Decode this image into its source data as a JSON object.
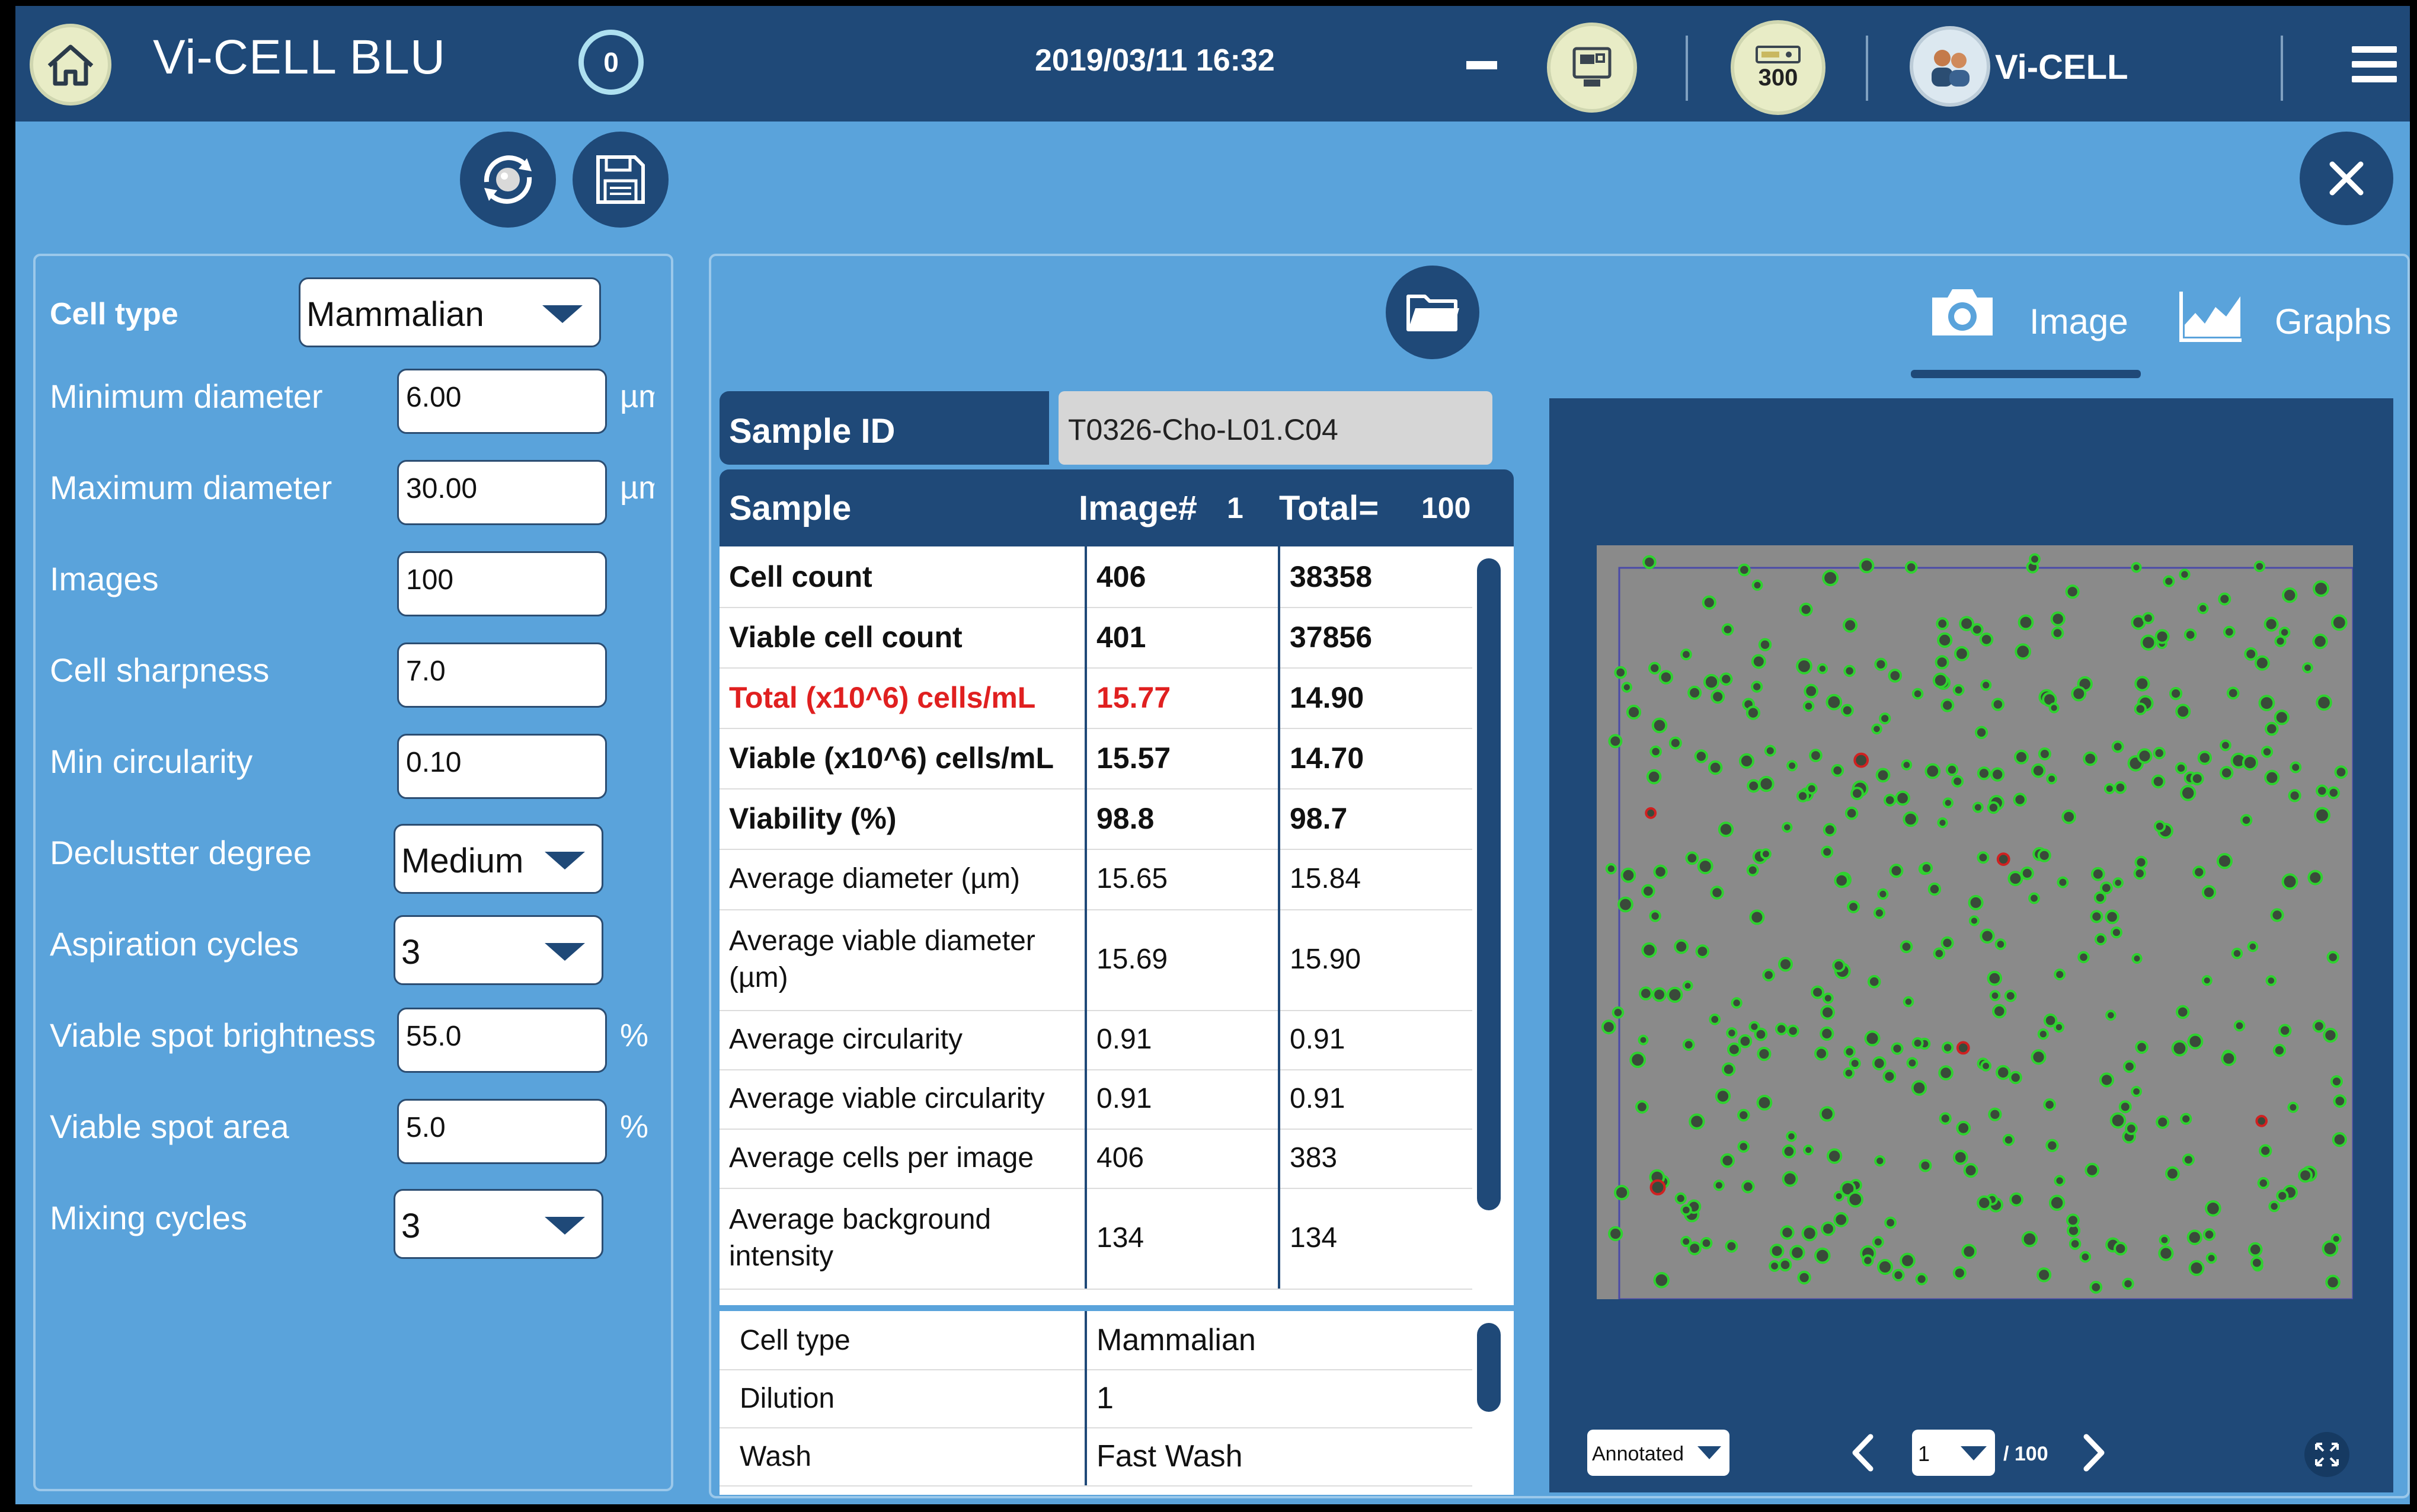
{
  "header": {
    "app_title": "Vi-CELL BLU",
    "queue_count": "0",
    "datetime": "2019/03/11 16:32",
    "reagent_count": "300",
    "user_name": "Vi-CELL"
  },
  "params": {
    "cell_type": {
      "label": "Cell type",
      "value": "Mammalian"
    },
    "min_diameter": {
      "label": "Minimum diameter",
      "value": "6.00",
      "unit": "µm"
    },
    "max_diameter": {
      "label": "Maximum diameter",
      "value": "30.00",
      "unit": "µm"
    },
    "images": {
      "label": "Images",
      "value": "100"
    },
    "cell_sharpness": {
      "label": "Cell sharpness",
      "value": "7.0"
    },
    "min_circularity": {
      "label": "Min circularity",
      "value": "0.10"
    },
    "decluster": {
      "label": "Declustter degree",
      "value": "Medium"
    },
    "aspiration": {
      "label": "Aspiration cycles",
      "value": "3"
    },
    "spot_brightness": {
      "label": "Viable spot brightness",
      "value": "55.0",
      "unit": "%"
    },
    "spot_area": {
      "label": "Viable spot area",
      "value": "5.0",
      "unit": "%"
    },
    "mixing": {
      "label": "Mixing cycles",
      "value": "3"
    }
  },
  "sample": {
    "id_label": "Sample ID",
    "id_value": "T0326-Cho-L01.C04",
    "header_label": "Sample",
    "image_label": "Image#",
    "image_num": "1",
    "total_label": "Total=",
    "total_num": "100"
  },
  "results": [
    {
      "label": "Cell count",
      "image": "406",
      "total": "38358",
      "style": "bold"
    },
    {
      "label": "Viable cell count",
      "image": "401",
      "total": "37856",
      "style": "bold"
    },
    {
      "label": "Total (x10^6) cells/mL",
      "image": "15.77",
      "total": "14.90",
      "style": "red"
    },
    {
      "label": "Viable (x10^6) cells/mL",
      "image": "15.57",
      "total": "14.70",
      "style": "bold"
    },
    {
      "label": "Viability (%)",
      "image": "98.8",
      "total": "98.7",
      "style": "bold"
    },
    {
      "label": "Average diameter (µm)",
      "image": "15.65",
      "total": "15.84",
      "style": "normal"
    },
    {
      "label": "Average viable diameter (µm)",
      "image": "15.69",
      "total": "15.90",
      "style": "normal"
    },
    {
      "label": "Average circularity",
      "image": "0.91",
      "total": "0.91",
      "style": "normal"
    },
    {
      "label": "Average viable circularity",
      "image": "0.91",
      "total": "0.91",
      "style": "normal"
    },
    {
      "label": "Average cells per image",
      "image": "406",
      "total": "383",
      "style": "normal"
    },
    {
      "label": "Average background intensity",
      "image": "134",
      "total": "134",
      "style": "normal"
    }
  ],
  "info": [
    {
      "label": "Cell type",
      "value": "Mammalian"
    },
    {
      "label": "Dilution",
      "value": "1"
    },
    {
      "label": "Wash",
      "value": "Fast Wash"
    }
  ],
  "tabs": {
    "image": "Image",
    "graphs": "Graphs"
  },
  "viewer": {
    "mode": "Annotated",
    "page": "1",
    "page_total": "/ 100"
  },
  "colors": {
    "background": "#5aa3db",
    "dark_blue": "#1f4978",
    "accent_red": "#e02020"
  }
}
